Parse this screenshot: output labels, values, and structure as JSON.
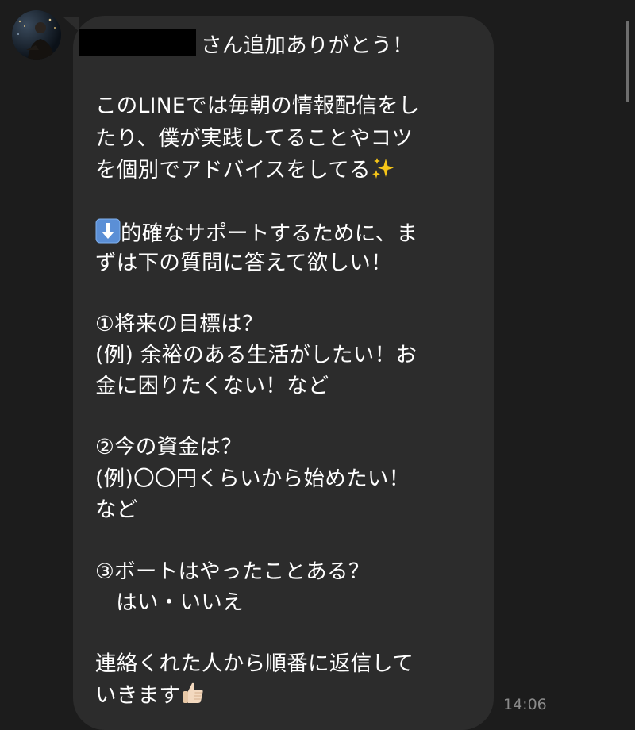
{
  "message": {
    "greeting_suffix": "さん追加ありがとう！",
    "lines": [
      "このLINEでは毎朝の情報配信をし",
      "たり、僕が実践してることやコツ",
      "を個別でアドバイスをしてる",
      "的確なサポートするために、ま",
      "ずは下の質問に答えて欲しい！",
      "①将来の目標は？",
      "(例) 余裕のある生活がしたい！お",
      "金に困りたくない！など",
      "②今の資金は？",
      "(例)〇〇円くらいから始めたい！",
      "など",
      "③ボートはやったことある？",
      "   はい・いいえ",
      "連絡くれた人から順番に返信して",
      "いきます"
    ],
    "timestamp": "14:06"
  },
  "icons": {
    "sparkles": "sparkles-icon",
    "down_arrow": "down-arrow-icon",
    "thumbs_up": "thumbs-up-icon"
  },
  "colors": {
    "background": "#1c1c1c",
    "bubble": "#2c2c2c",
    "text": "#ffffff",
    "timestamp": "#8a8a8a"
  }
}
